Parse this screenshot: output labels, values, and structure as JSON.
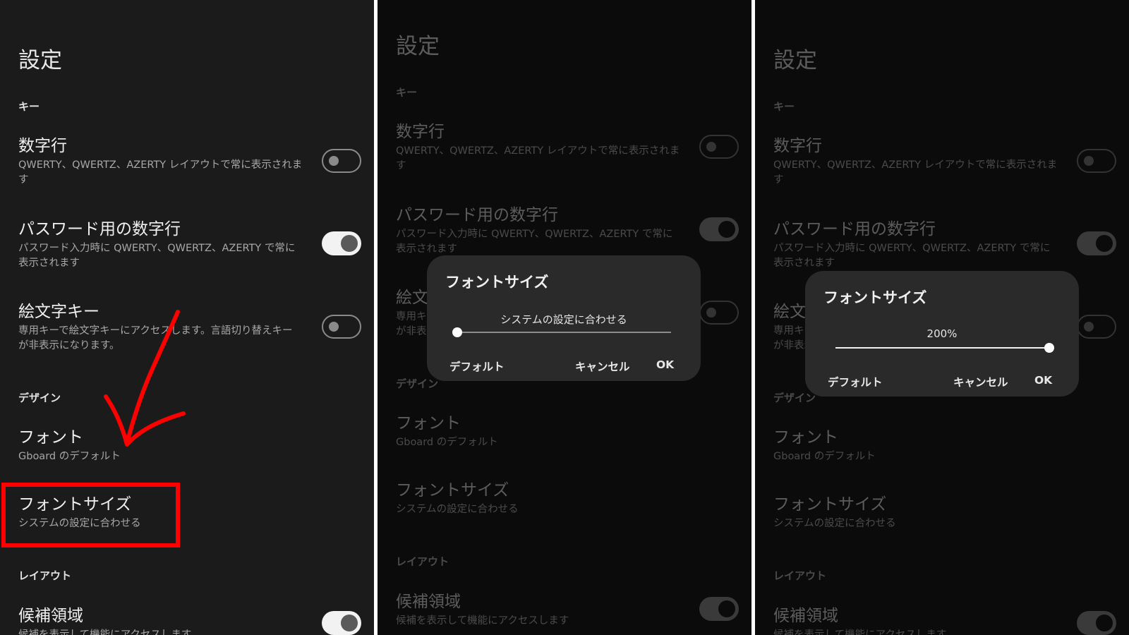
{
  "panels": {
    "normal": {
      "title": "設定",
      "sections": {
        "keys": "キー",
        "design": "デザイン",
        "layout": "レイアウト"
      },
      "items": {
        "number_row": {
          "title": "数字行",
          "sub_line1": "QWERTY、QWERTZ、AZERTY レイアウトで常に表示されま",
          "sub_line2": "す"
        },
        "password_number_row": {
          "title": "パスワード用の数字行",
          "sub_line1": "パスワード入力時に QWERTY、QWERTZ、AZERTY で常に",
          "sub_line2": "表示されます"
        },
        "emoji_key": {
          "title": "絵文字キー",
          "sub_line1": "専用キーで絵文字キーにアクセスします。言語切り替えキー",
          "sub_line2": "が非表示になります。"
        },
        "font": {
          "title": "フォント",
          "sub": "Gboard のデフォルト"
        },
        "font_size": {
          "title": "フォントサイズ",
          "sub": "システムの設定に合わせる"
        },
        "suggestion_strip": {
          "title": "候補領域",
          "sub": "候補を表示して機能にアクセスします"
        }
      },
      "toggles": {
        "number_row": false,
        "password_number_row": true,
        "emoji_key": false,
        "suggestion_strip": true
      }
    },
    "dialog_system": {
      "title": "フォントサイズ",
      "value_label": "システムの設定に合わせる",
      "slider_value": 0,
      "buttons": {
        "default": "デフォルト",
        "cancel": "キャンセル",
        "ok": "OK"
      }
    },
    "dialog_200": {
      "title": "フォントサイズ",
      "value_label": "200%",
      "slider_value": 1,
      "buttons": {
        "default": "デフォルト",
        "cancel": "キャンセル",
        "ok": "OK"
      }
    }
  },
  "colors": {
    "annotation": "#ff0000",
    "background": "#1b1b1b",
    "dialog": "#2a2a2a"
  }
}
